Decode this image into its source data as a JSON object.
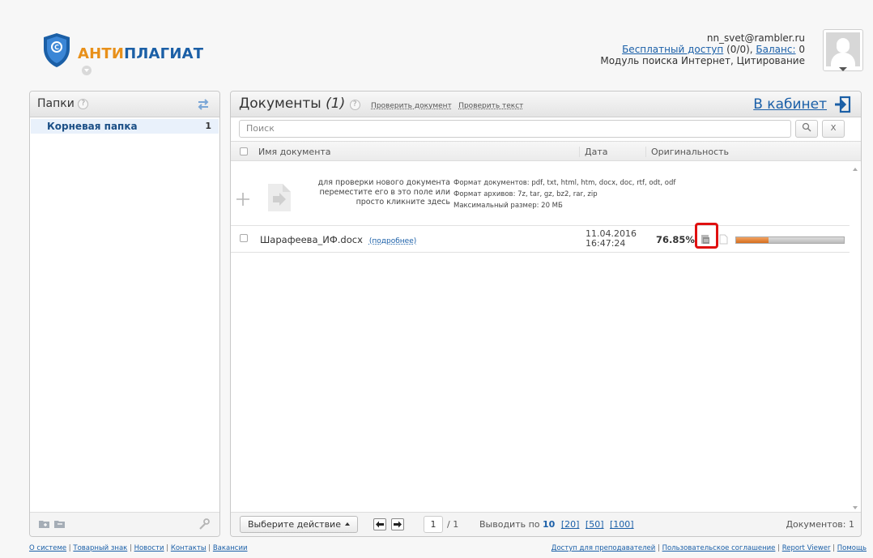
{
  "brand": {
    "part1": "АНТИ",
    "part2": "ПЛАГИАТ"
  },
  "user": {
    "email": "nn_svet@rambler.ru",
    "access_link": "Бесплатный доступ",
    "access_count": "(0/0),",
    "balance_link": "Баланс:",
    "balance_value": "0",
    "modules": "Модуль поиска Интернет, Цитирование"
  },
  "folders": {
    "title": "Папки",
    "help": "?",
    "items": [
      {
        "name": "Корневая папка",
        "count": "1"
      }
    ]
  },
  "docs": {
    "title": "Документы",
    "count": "(1)",
    "help": "?",
    "check_document": "Проверить документ",
    "check_text": "Проверить текст",
    "cabinet": "В кабинет",
    "search_placeholder": "Поиск",
    "search_btn": "⚲",
    "clear_btn": "X",
    "columns": {
      "name": "Имя документа",
      "date": "Дата",
      "originality": "Оригинальность"
    },
    "upload": {
      "line1": "для проверки нового документа",
      "line2": "переместите его в это поле или",
      "line3": "просто кликните здесь",
      "formats": "Формат документов: pdf, txt, html, htm, docx, doc, rtf, odt, odf",
      "archives": "Формат архивов: 7z, tar, gz, bz2, rar, zip",
      "max_size": "Максимальный размер: 20 МБ"
    },
    "rows": [
      {
        "name": "Шарафеева_ИФ.docx",
        "more": "(подробнее)",
        "date": "11.04.2016",
        "time": "16:47:24",
        "originality": "76.85%",
        "originality_value": 76.85,
        "bar_fill_fraction": 0.3
      }
    ],
    "footer": {
      "action": "Выберите действие",
      "page": "1",
      "pages": "/ 1",
      "per_page_label": "Выводить по",
      "per_page_current": "10",
      "per_page_options": [
        "[20]",
        "[50]",
        "[100]"
      ],
      "total": "Документов: 1"
    }
  },
  "footer_links_left": [
    "О системе",
    "Товарный знак",
    "Новости",
    "Контакты",
    "Вакансии"
  ],
  "footer_links_right": [
    "Доступ для преподавателей",
    "Пользовательское соглашение",
    "Report Viewer",
    "Помощь"
  ],
  "colors": {
    "brand_orange": "#e8901a",
    "brand_blue": "#1b5fa6",
    "highlight_red": "#e01010",
    "bar_orange": "#e07a2a"
  }
}
